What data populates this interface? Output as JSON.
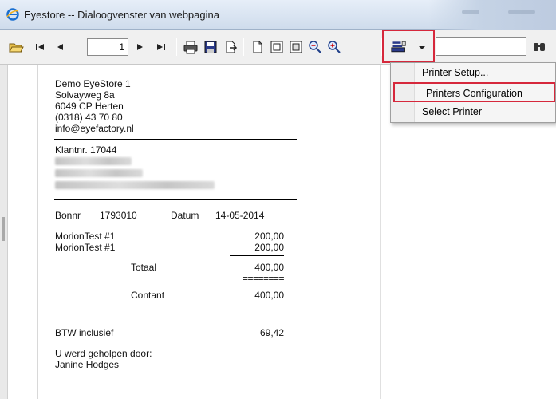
{
  "window": {
    "title": "Eyestore -- Dialoogvenster van webpagina"
  },
  "toolbar": {
    "page_number": "1",
    "icons": [
      "open-icon",
      "first-page-icon",
      "prev-page-icon",
      "next-page-icon",
      "last-page-icon",
      "print-icon",
      "save-icon",
      "export-icon",
      "single-page-icon",
      "two-page-icon",
      "multi-page-icon",
      "zoom-out-icon",
      "zoom-in-icon",
      "printer-settings-icon",
      "dropdown-arrow-icon",
      "find-icon"
    ]
  },
  "menu": {
    "items": [
      {
        "label": "Printer Setup..."
      },
      {
        "label": "Printers Configuration"
      },
      {
        "label": "Select Printer"
      }
    ]
  },
  "receipt": {
    "store": {
      "name": "Demo EyeStore 1",
      "street": "Solvayweg 8a",
      "postal": "6049 CP Herten",
      "phone": "(0318) 43 70 80",
      "email": "info@eyefactory.nl"
    },
    "customer": {
      "number": "Klantnr. 17044"
    },
    "bon_label": "Bonnr",
    "bon_number": "1793010",
    "date_label": "Datum",
    "date": "14-05-2014",
    "lines": [
      {
        "item": "MorionTest #1",
        "amount": "200,00"
      },
      {
        "item": "MorionTest #1",
        "amount": "200,00"
      }
    ],
    "total_label": "Totaal",
    "total": "400,00",
    "double_rule": "========",
    "payment_label": "Contant",
    "payment": "400,00",
    "vat_label": "BTW inclusief",
    "vat": "69,42",
    "helped_by_label": "U werd geholpen door:",
    "helped_by": "Janine Hodges"
  },
  "colors": {
    "highlight": "#d6283c",
    "toolbar_bg": "#f0f0f0"
  }
}
